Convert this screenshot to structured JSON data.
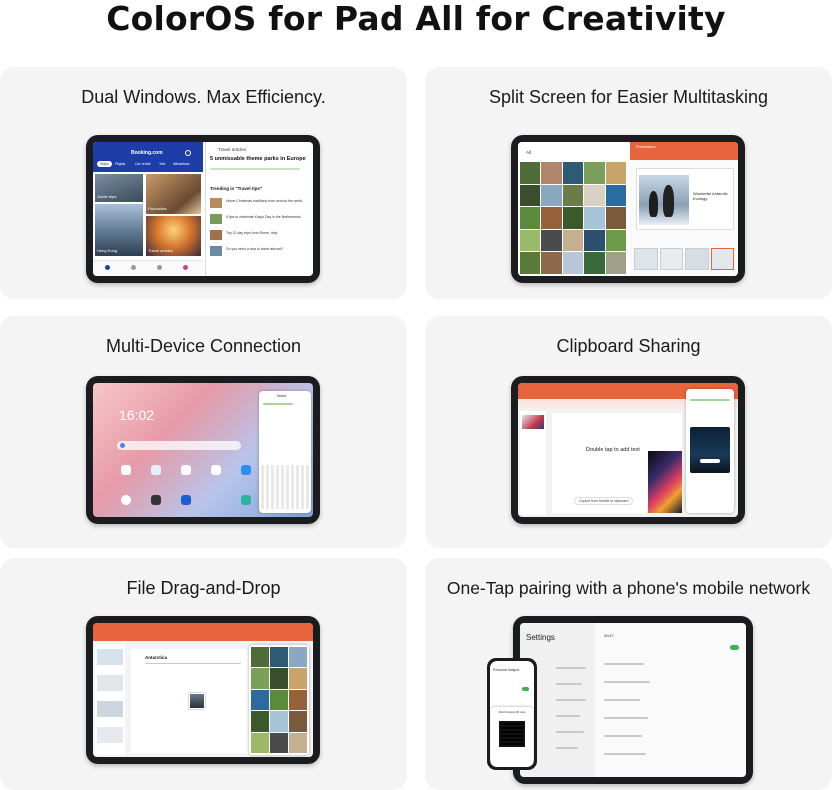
{
  "page_title": "ColorOS for Pad All for Creativity",
  "cards": [
    {
      "title": "Dual Windows. Max Efficiency."
    },
    {
      "title": "Split Screen for Easier Multitasking"
    },
    {
      "title": "Multi-Device Connection"
    },
    {
      "title": "Clipboard Sharing"
    },
    {
      "title": "File Drag-and-Drop"
    },
    {
      "title": "One-Tap pairing with a phone's mobile network"
    }
  ],
  "dual": {
    "app_title": "Booking.com",
    "tab_stays": "Stays",
    "tab_flights": "Flights",
    "tab_car": "Car rental",
    "tab_taxi": "Taxi",
    "tab_attr": "Attractions",
    "label_guide": "Guide trips",
    "label_fav": "Favourites",
    "label_city": "Hong Kong",
    "label_travel": "Travel articles",
    "right_header": "Travel articles",
    "right_title": "5 unmissable theme parks in Europe",
    "right_trending": "Trending in \"Travel tips\"",
    "articles": [
      "Home Christmas traditions from around the world",
      "5 tips to celebrate King's Day in the Netherlands",
      "Top 10 day trips from Rome, Italy",
      "Do you need a visa to travel abroad?"
    ]
  },
  "split": {
    "gallery_header": "All",
    "slide_header": "Presentation",
    "slide_title": "Wonderful Antarctic Ecology"
  },
  "multi": {
    "clock": "16:02",
    "note_header": "Noted"
  },
  "clip": {
    "slide_placeholder": "Double tap to add text",
    "toast": "Copied from Mobile to clipboard"
  },
  "drag": {
    "doc_title": "Antarctica"
  },
  "pair": {
    "settings_title": "Settings",
    "wlan": "Wi-Fi",
    "phone_header": "Personal hotspot",
    "qr_label": "WLAN hotspot QR code"
  },
  "colors": {
    "booking_blue": "#1d3ea8",
    "office_orange": "#e8643c",
    "accent_green": "#3bb34a"
  }
}
